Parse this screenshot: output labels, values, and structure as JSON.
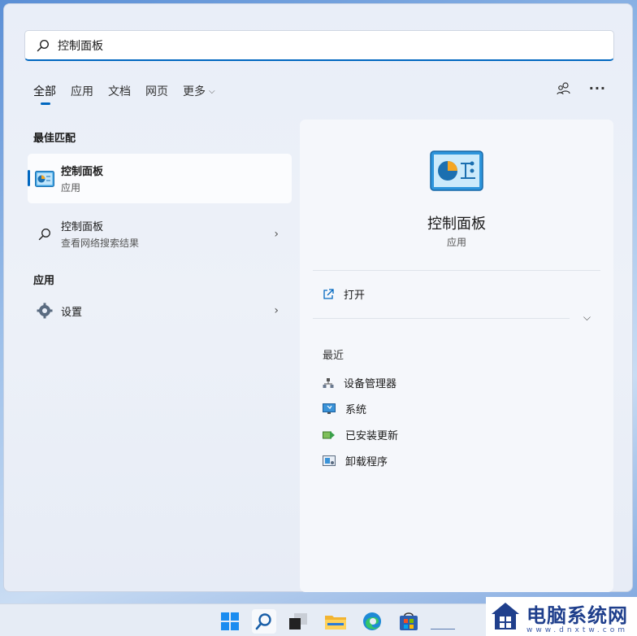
{
  "search": {
    "value": "控制面板"
  },
  "tabs": [
    {
      "label": "全部",
      "active": true
    },
    {
      "label": "应用"
    },
    {
      "label": "文档"
    },
    {
      "label": "网页"
    },
    {
      "label": "更多"
    }
  ],
  "top_right_icons": [
    "people-icon",
    "more-icon"
  ],
  "sections": {
    "best_match_title": "最佳匹配",
    "apps_title": "应用"
  },
  "best_match": {
    "title": "控制面板",
    "subtitle": "应用"
  },
  "web_result": {
    "title": "控制面板",
    "subtitle": "查看网络搜索结果"
  },
  "app_result": {
    "title": "设置"
  },
  "detail": {
    "title": "控制面板",
    "subtitle": "应用",
    "open_label": "打开",
    "recent_title": "最近",
    "recent": [
      {
        "label": "设备管理器",
        "icon": "device-manager-icon"
      },
      {
        "label": "系统",
        "icon": "system-icon"
      },
      {
        "label": "已安装更新",
        "icon": "installed-updates-icon"
      },
      {
        "label": "卸载程序",
        "icon": "uninstall-icon"
      }
    ]
  },
  "taskbar": [
    "start-icon",
    "search-icon",
    "task-view-icon",
    "file-explorer-icon",
    "edge-icon",
    "store-icon"
  ],
  "watermark": {
    "text": "电脑系统网",
    "url": "www.dnxtw.com"
  },
  "colors": {
    "accent": "#0067c0",
    "brand": "#1f3f8c"
  }
}
